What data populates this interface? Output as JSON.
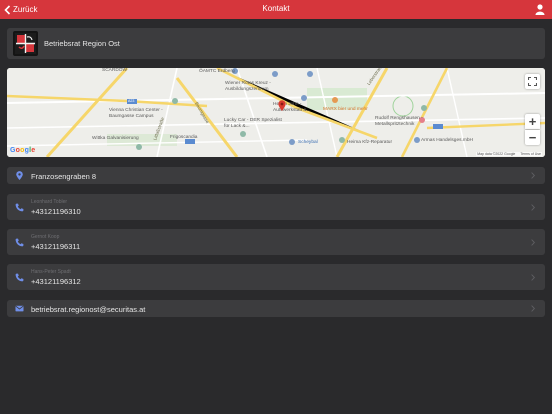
{
  "header": {
    "back_label": "Zurück",
    "title": "Kontakt"
  },
  "organization": {
    "name": "Betriebsrat Region Ost"
  },
  "map": {
    "labels": [
      "SCARDOW",
      "ÖAMTC Erdberg",
      "Wiener Rotes Kreuz - Ausbildungszentrum",
      "Helfen John - Autowerkstatt &...",
      "MARX bier und mehr",
      "Vienna Christian Center - Baumgasse Campus",
      "Lucky Car - DER Spezialist für Lack &...",
      "Rudolf Rengshausen - Metallspritztechnik",
      "Wittka Galvanisierung",
      "Frigoscandia",
      "Scheybal",
      "Heima Kfz-Reparatur",
      "Armas Handelsges.mbH",
      "Baumgasse",
      "Leberstraße",
      "Litfaßstraße",
      "A23",
      "Google"
    ],
    "attribution": "Map data ©2022 Google",
    "terms": "Terms of Use",
    "zoom_in": "+",
    "zoom_out": "−"
  },
  "contacts": [
    {
      "icon": "location-pin-icon",
      "title": "",
      "value": "Franzosengraben 8"
    },
    {
      "icon": "phone-icon",
      "title": "Leonhard Tobler",
      "value": "+43121196310"
    },
    {
      "icon": "phone-icon",
      "title": "Gernot Koop",
      "value": "+43121196311"
    },
    {
      "icon": "phone-icon",
      "title": "Hans-Peter Spadt",
      "value": "+43121196312"
    },
    {
      "icon": "mail-icon",
      "title": "",
      "value": "betriebsrat.regionost@securitas.at"
    }
  ],
  "colors": {
    "header": "#d6363c",
    "background": "#2a2a2c",
    "card": "#3c3c3e",
    "icon": "#6f8ee8"
  }
}
